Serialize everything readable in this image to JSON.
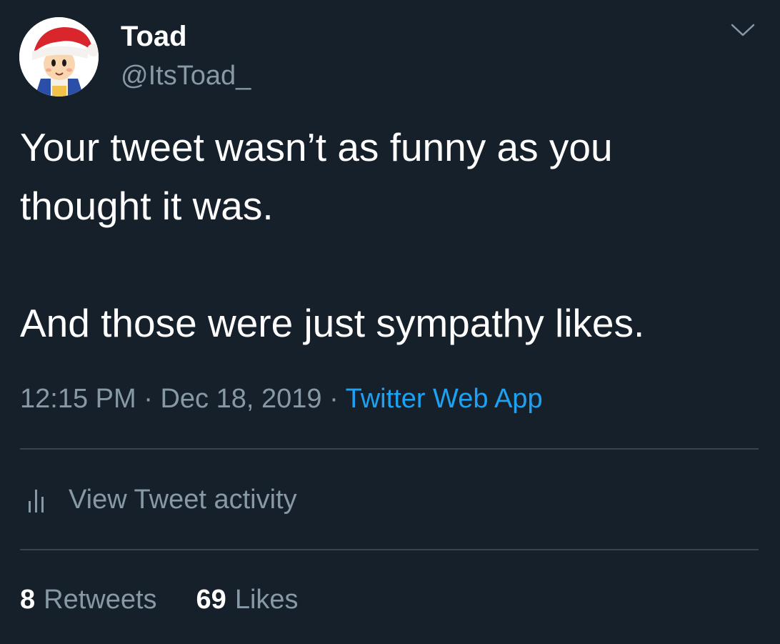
{
  "author": {
    "display_name": "Toad",
    "handle": "@ItsToad_"
  },
  "tweet": {
    "text": "Your tweet wasn’t as funny as you\nthought it was.\n\nAnd those were just sympathy likes.",
    "time": "12:15 PM",
    "separator": "·",
    "date": "Dec 18, 2019",
    "source": "Twitter Web App"
  },
  "activity": {
    "label": "View Tweet activity",
    "icon": "bar-chart-icon"
  },
  "stats": {
    "retweets_count": "8",
    "retweets_label": "Retweets",
    "likes_count": "69",
    "likes_label": "Likes"
  },
  "icons": {
    "menu": "chevron-down-icon",
    "avatar": "toad-santa-hat-avatar"
  },
  "colors": {
    "background": "#15202b",
    "text_primary": "#ffffff",
    "text_secondary": "#8899a6",
    "accent": "#1da1f2",
    "divider": "#38444d"
  }
}
